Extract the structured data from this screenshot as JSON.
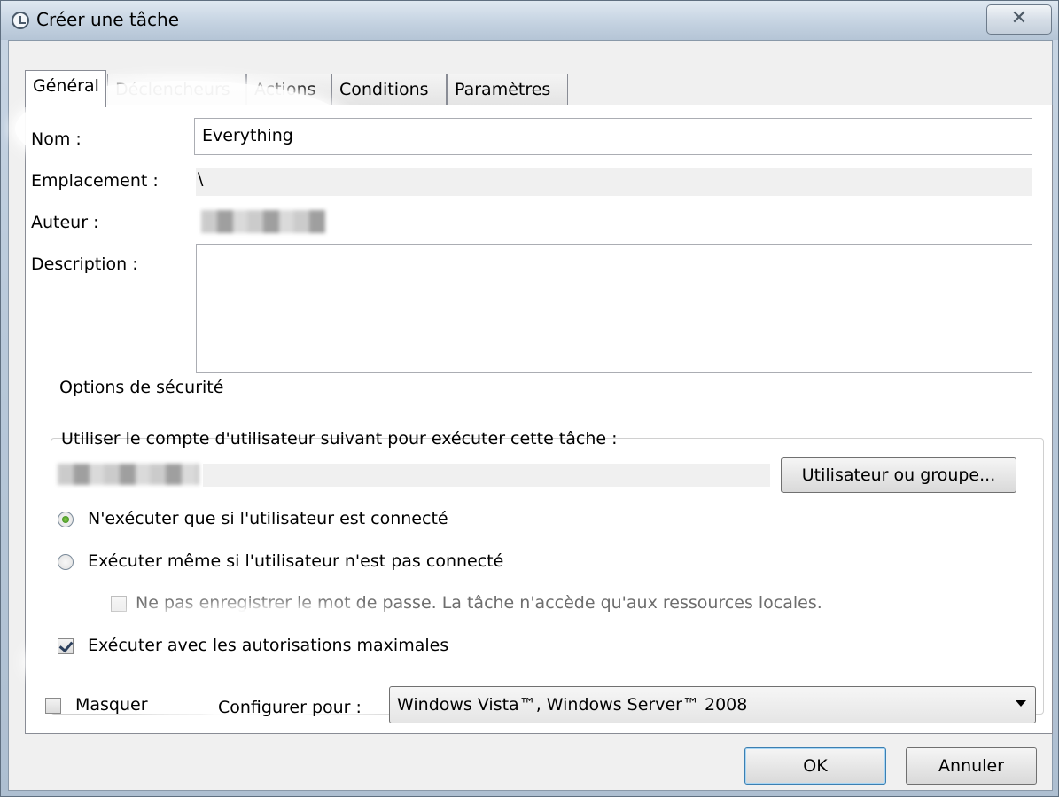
{
  "window": {
    "title": "Créer une tâche",
    "close_glyph": "✕"
  },
  "tabs": [
    {
      "label": "Général",
      "active": true
    },
    {
      "label": "Déclencheurs",
      "active": false
    },
    {
      "label": "Actions",
      "active": false
    },
    {
      "label": "Conditions",
      "active": false
    },
    {
      "label": "Paramètres",
      "active": false
    }
  ],
  "general": {
    "name_label": "Nom :",
    "name_value": "Everything",
    "location_label": "Emplacement :",
    "location_value": "\\",
    "author_label": "Auteur :",
    "description_label": "Description :",
    "description_value": ""
  },
  "security": {
    "legend": "Options de sécurité",
    "account_prompt": "Utiliser le compte d'utilisateur suivant pour exécuter cette tâche :",
    "user_group_button": "Utilisateur ou groupe...",
    "radio_logged_on": "N'exécuter que si l'utilisateur est connecté",
    "radio_logged_on_selected": true,
    "radio_whether_logged": "Exécuter même si l'utilisateur n'est pas connecté",
    "no_store_password": "Ne pas enregistrer le mot de passe. La tâche n'accède qu'aux ressources locales.",
    "no_store_password_checked": false,
    "run_highest": "Exécuter avec les autorisations maximales",
    "run_highest_checked": true
  },
  "bottom": {
    "hidden_label": "Masquer",
    "hidden_checked": false,
    "configure_label": "Configurer pour :",
    "configure_value": "Windows Vista™, Windows Server™ 2008"
  },
  "buttons": {
    "ok": "OK",
    "cancel": "Annuler"
  }
}
